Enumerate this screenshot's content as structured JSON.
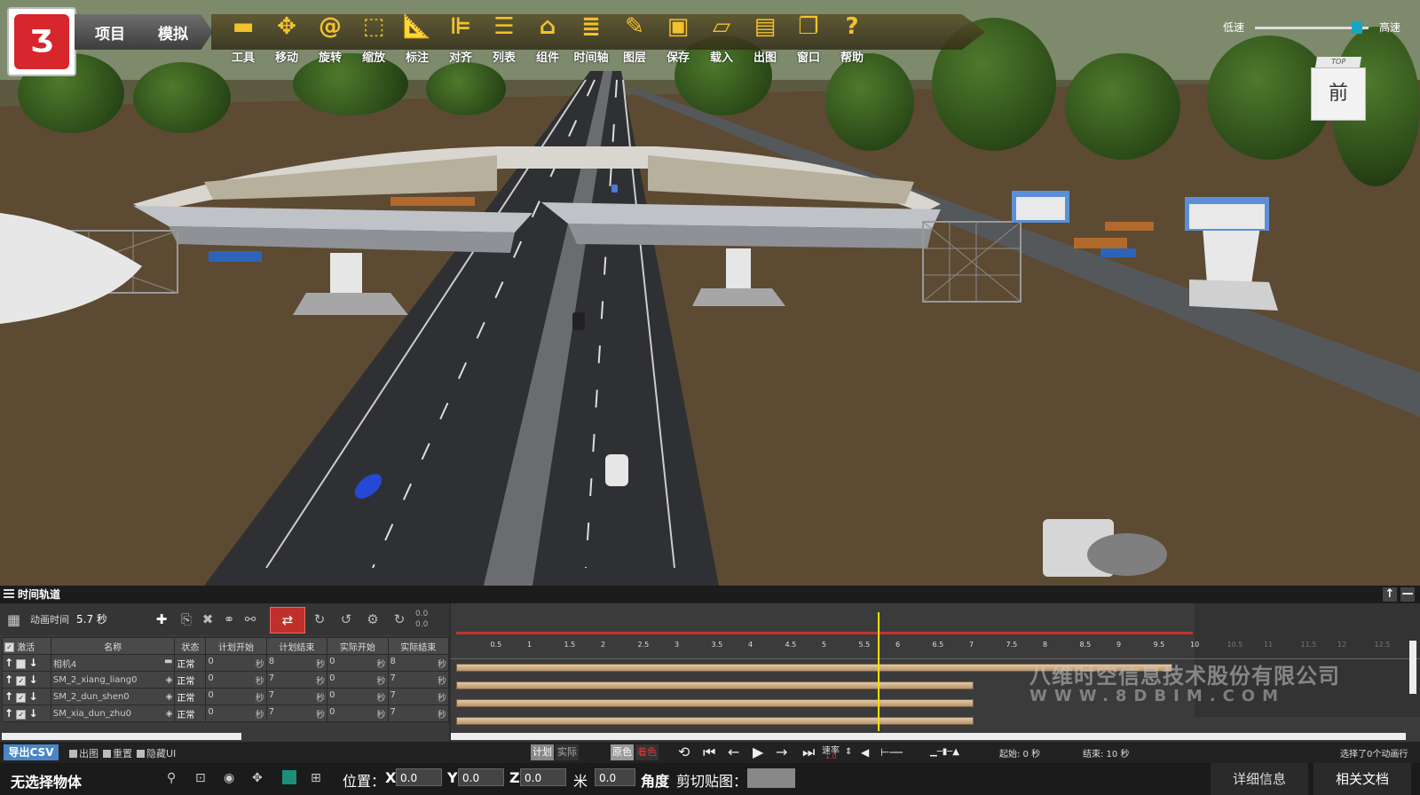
{
  "toolbar": {
    "crumbs": [
      "项目",
      "模拟"
    ],
    "tools": [
      {
        "label": "工具",
        "icon": "tools-icon"
      },
      {
        "label": "移动",
        "icon": "move-icon"
      },
      {
        "label": "旋转",
        "icon": "rotate-icon"
      },
      {
        "label": "缩放",
        "icon": "scale-icon"
      },
      {
        "label": "标注",
        "icon": "measure-icon"
      },
      {
        "label": "对齐",
        "icon": "align-icon"
      },
      {
        "label": "列表",
        "icon": "list-icon"
      },
      {
        "label": "组件",
        "icon": "component-icon"
      },
      {
        "label": "时间轴",
        "icon": "timeline-icon"
      },
      {
        "label": "图层",
        "icon": "layer-icon"
      },
      {
        "label": "保存",
        "icon": "save-icon"
      },
      {
        "label": "载入",
        "icon": "folder-open-icon"
      },
      {
        "label": "出图",
        "icon": "export-image-icon"
      },
      {
        "label": "窗口",
        "icon": "window-icon"
      },
      {
        "label": "帮助",
        "icon": "help-icon"
      }
    ],
    "accent_color": "#f3c12c"
  },
  "speed": {
    "low": "低速",
    "high": "高速",
    "level": 0.9
  },
  "viewcube": {
    "top": "TOP",
    "front": "前"
  },
  "timeline": {
    "title": "时间轨道",
    "anim_time_label": "动画时间",
    "anim_time_value": "5.7 秒",
    "range_values": [
      "0.0",
      "0.0"
    ],
    "columns": [
      "激活",
      "名称",
      "状态",
      "计划开始",
      "计划结束",
      "实际开始",
      "实际结束"
    ],
    "rows": [
      {
        "name": "相机4",
        "status": "正常",
        "plan_start": "0",
        "plan_end": "8",
        "actual_start": "0",
        "actual_end": "8",
        "unit": "秒",
        "end_value": 9.7
      },
      {
        "name": "SM_2_xiang_liang0",
        "status": "正常",
        "plan_start": "0",
        "plan_end": "7",
        "actual_start": "0",
        "actual_end": "7",
        "unit": "秒",
        "end_value": 7
      },
      {
        "name": "SM_2_dun_shen0",
        "status": "正常",
        "plan_start": "0",
        "plan_end": "7",
        "actual_start": "0",
        "actual_end": "7",
        "unit": "秒",
        "end_value": 7
      },
      {
        "name": "SM_xia_dun_zhu0",
        "status": "正常",
        "plan_start": "0",
        "plan_end": "7",
        "actual_start": "0",
        "actual_end": "7",
        "unit": "秒",
        "end_value": 7
      }
    ],
    "ruler_ticks": [
      "0.5",
      "1",
      "1.5",
      "2",
      "2.5",
      "3",
      "3.5",
      "4",
      "4.5",
      "5",
      "5.5",
      "6",
      "6.5",
      "7",
      "7.5",
      "8",
      "8.5",
      "9",
      "9.5",
      "10",
      "10.5",
      "11",
      "11.5",
      "12",
      "12.5"
    ],
    "playhead": 5.7,
    "range_end": 10,
    "watermark_line1": "八维时空信息技术股份有限公司",
    "watermark_line2": "WWW.8DBIM.COM"
  },
  "controls": {
    "export_csv": "导出CSV",
    "options": [
      "出图",
      "重置",
      "隐藏UI"
    ],
    "plan_actual": [
      "计划",
      "实际"
    ],
    "color_modes": [
      "原色",
      "着色"
    ],
    "rate_label": "速率",
    "rate_value": "1.0",
    "start_label": "起始: 0 秒",
    "end_label": "结束: 10 秒",
    "selection_info": "选择了0个动画行"
  },
  "statusbar": {
    "selection": "无选择物体",
    "position_label": "位置：",
    "x_label": "X",
    "y_label": "Y",
    "z_label": "Z",
    "x_value": "0.0",
    "y_value": "0.0",
    "z_value": "0.0",
    "unit": "米",
    "angle_value": "0.0",
    "angle_label": "角度",
    "clip_label": "剪切贴图：",
    "details_tab": "详细信息",
    "docs_tab": "相关文档"
  }
}
